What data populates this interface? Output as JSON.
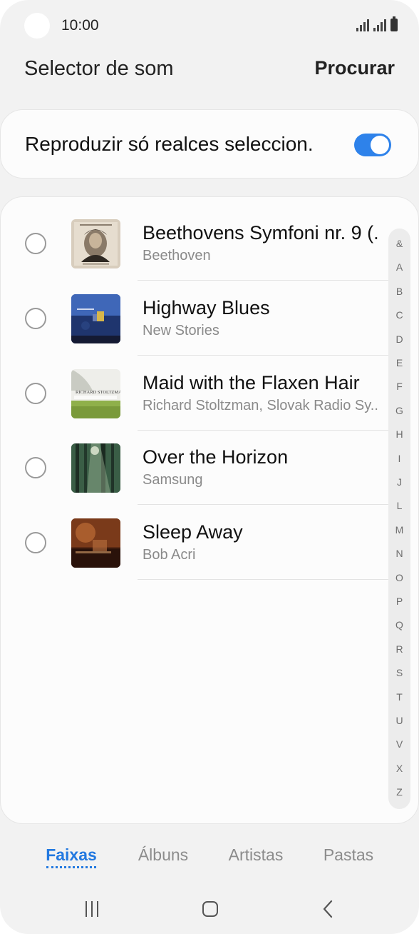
{
  "status_bar": {
    "time": "10:00"
  },
  "header": {
    "title": "Selector de som",
    "action": "Procurar"
  },
  "toggle": {
    "label": "Reproduzir só realces seleccion.",
    "on": true,
    "accent": "#2e82ea"
  },
  "tracks": [
    {
      "title": "Beethovens Symfoni nr. 9 (..",
      "artist": "Beethoven",
      "art": "beethoven-portrait-art"
    },
    {
      "title": "Highway Blues",
      "artist": "New Stories",
      "art": "blue-night-city-art"
    },
    {
      "title": "Maid with the Flaxen Hair",
      "artist": "Richard Stoltzman, Slovak Radio Sy..",
      "art": "richard-stoltzman-cover-art",
      "art_text": "RICHARD STOLTZMAN"
    },
    {
      "title": "Over the Horizon",
      "artist": "Samsung",
      "art": "forest-light-art"
    },
    {
      "title": "Sleep Away",
      "artist": "Bob Acri",
      "art": "piano-warm-art"
    }
  ],
  "index_letters": [
    "&",
    "A",
    "B",
    "C",
    "D",
    "E",
    "F",
    "G",
    "H",
    "I",
    "J",
    "L",
    "M",
    "N",
    "O",
    "P",
    "Q",
    "R",
    "S",
    "T",
    "U",
    "V",
    "X",
    "Z"
  ],
  "tabs": [
    {
      "label": "Faixas",
      "active": true
    },
    {
      "label": "Álbuns",
      "active": false
    },
    {
      "label": "Artistas",
      "active": false
    },
    {
      "label": "Pastas",
      "active": false
    }
  ],
  "colors": {
    "accent": "#2379e0",
    "background": "#f2f2f2",
    "card": "#fcfcfc"
  }
}
